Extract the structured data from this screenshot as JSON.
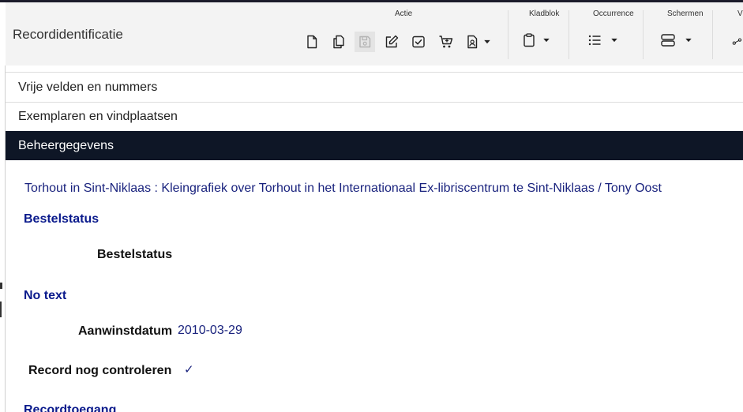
{
  "header": {
    "record_title": "Recordidentificatie"
  },
  "toolbar": {
    "groups": {
      "actie": "Actie",
      "kladblok": "Kladblok",
      "occurrence": "Occurrence",
      "schermen": "Schermen",
      "partial": "V"
    },
    "icons": [
      "new-document-icon",
      "copy-icon",
      "save-icon",
      "edit-icon",
      "checkbox-icon",
      "cart-icon",
      "document-user-icon",
      "clipboard-icon",
      "list-icon",
      "screens-icon",
      "share-icon"
    ]
  },
  "accordion": {
    "items": [
      {
        "label": "Vrije velden en nummers"
      },
      {
        "label": "Exemplaren en vindplaatsen"
      },
      {
        "label": "Beheergegevens"
      }
    ]
  },
  "main": {
    "record_line": "Torhout in Sint-Niklaas : Kleingrafiek over Torhout in het Internationaal Ex-libriscentrum te Sint-Niklaas / Tony Oost",
    "sections": [
      {
        "title": "Bestelstatus"
      },
      {
        "title": "No text"
      },
      {
        "title": "Recordtoegang"
      }
    ],
    "fields": {
      "bestelstatus_label": "Bestelstatus",
      "aanwinstdatum_label": "Aanwinstdatum",
      "aanwinstdatum_value": "2010-03-29",
      "controleren_label": "Record nog controleren",
      "controleren_value": "✓"
    }
  },
  "colors": {
    "active_bar": "#0e1626",
    "section_heading": "#0a1a8c",
    "record_link": "#1a237e",
    "toolbar_bg": "#f3f3f3"
  }
}
